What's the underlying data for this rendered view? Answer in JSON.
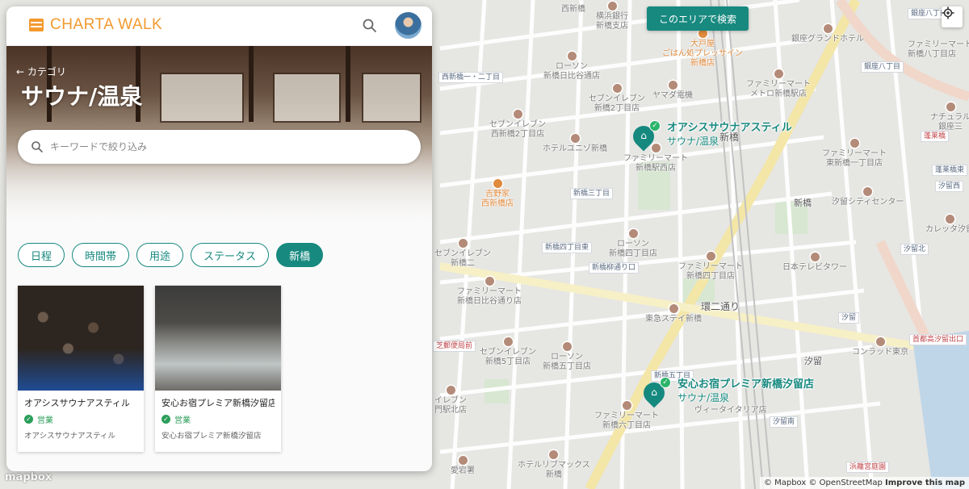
{
  "app": {
    "brand": "CHARTA WALK",
    "brand_color": "#f29a2e",
    "accent_color": "#17897f"
  },
  "header": {
    "back_label": "← カテゴリ",
    "title": "サウナ/温泉",
    "search_placeholder": "キーワードで絞り込み"
  },
  "filters": [
    {
      "label": "日程",
      "active": false
    },
    {
      "label": "時間帯",
      "active": false
    },
    {
      "label": "用途",
      "active": false
    },
    {
      "label": "ステータス",
      "active": false
    },
    {
      "label": "新橋",
      "active": true
    }
  ],
  "cards": [
    {
      "title": "オアシスサウナアスティル",
      "status": "営業",
      "subtitle": "オアシスサウナアスティル"
    },
    {
      "title": "安心お宿プレミア新橋汐留店",
      "status": "営業",
      "subtitle": "安心お宿プレミア新橋汐留店"
    }
  ],
  "map": {
    "search_area_label": "このエリアで検索",
    "markers": [
      {
        "title": "オアシスサウナアスティル",
        "category": "サウナ/温泉"
      },
      {
        "title": "安心お宿プレミア新橋汐留店",
        "category": "サウナ/温泉"
      }
    ],
    "labels": {
      "l1": "西新橋",
      "l2": "横浜銀行\n新橋支店",
      "l3": "大戸屋\nごはん処プレッサイン\n新橋店",
      "l4": "銀座グランドホテル",
      "l5": "ローソン\n新橋日比谷通店",
      "l6": "西新橋一・二丁目",
      "l7": "ヤマダ電機",
      "l8": "ファミリーマート\nメトロ新橋駅店",
      "l9": "セブンイレブン\n新橋2丁目店",
      "l10": "セブンイレブン\n西新橋2丁目店",
      "l11": "ホテルユニゾ新橋",
      "l12": "ファミリーマート\n新橋駅西店",
      "l13": "新橋",
      "l14": "ファミリーマート\n東新橋一丁目店",
      "l15": "吉野家\n西新橋店",
      "l16": "新橋三丁目",
      "l17": "新橋",
      "l18": "汐留シティセンター",
      "l19": "カレッタ汐留",
      "l20": "新橋四丁目東",
      "l21": "ローソン\n新橋四丁目店",
      "l22": "新橋柳通り口",
      "l23": "ファミリーマート\n新橋四丁目店",
      "l24": "日本テレビタワー",
      "l25": "汐留北",
      "l26": "ファミリーマート\n新橋日比谷通り店",
      "l27": "環二通り",
      "l28": "東急ステイ新橋",
      "l29": "汐留",
      "l30": "首都高汐留出口",
      "l31": "セブンイレブン\n新橋5丁目店",
      "l32": "ローソン\n新橋五丁目店",
      "l33": "汐留",
      "l34": "コンラッド東京",
      "l35": "新橋五丁目",
      "l36": "ヴィータイタリア店",
      "l37": "ファミリーマート\n新橋六丁目店",
      "l38": "汐留南",
      "l39": "愛宕署",
      "l40": "ホテルリブマックス\n新橋",
      "l41": "浜離宮庭園",
      "l42": "ファミリーマート\n新橋八丁目店",
      "l43": "銀座八丁目",
      "l44": "ナチュラル\n銀座三",
      "l45": "ファミリーマート\n銀座八丁目",
      "l46": "浜離宮",
      "l47": "蓬莱橋",
      "l48": "蓬莱橋東",
      "l49": "銀座八丁目",
      "l50": "汐留西",
      "l51": "西新橋",
      "l52": "芝郵便局前",
      "l53": "セブンイレブン\n新橋二",
      "l54": "イレブン\n門駅北店",
      "l55": "首都高速"
    },
    "attribution": "© Mapbox © OpenStreetMap",
    "improve_label": "Improve this map",
    "logo_label": "mapbox"
  }
}
